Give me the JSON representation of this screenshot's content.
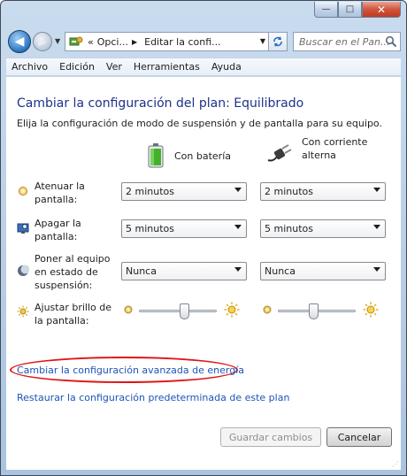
{
  "window": {
    "minimize_glyph": "—",
    "maximize_glyph": "□",
    "close_glyph": "✕"
  },
  "nav": {
    "back_glyph": "◀",
    "forward_glyph": "▶",
    "breadcrumb_prefix": "«",
    "crumb1": "Opci...",
    "crumb2": "Editar la confi...",
    "search_placeholder": "Buscar en el Pan..."
  },
  "menu": {
    "items": [
      "Archivo",
      "Edición",
      "Ver",
      "Herramientas",
      "Ayuda"
    ]
  },
  "page": {
    "title": "Cambiar la configuración del plan: Equilibrado",
    "subtitle": "Elija la configuración de modo de suspensión y de pantalla para su equipo.",
    "col_battery": "Con batería",
    "col_ac_line1": "Con corriente",
    "col_ac_line2": "alterna"
  },
  "settings": {
    "dim": {
      "label_line1": "Atenuar la",
      "label_line2": "pantalla:",
      "battery": "2 minutos",
      "ac": "2 minutos"
    },
    "off": {
      "label_line1": "Apagar la",
      "label_line2": "pantalla:",
      "battery": "5 minutos",
      "ac": "5 minutos"
    },
    "sleep": {
      "label_line1": "Poner al equipo",
      "label_line2": "en estado de",
      "label_line3": "suspensión:",
      "battery": "Nunca",
      "ac": "Nunca"
    },
    "brightness": {
      "label_line1": "Ajustar brillo de",
      "label_line2": "la pantalla:",
      "battery_level": 0.6,
      "ac_level": 0.45
    }
  },
  "links": {
    "advanced": "Cambiar la configuración avanzada de energía",
    "restore": "Restaurar la configuración predeterminada de este plan"
  },
  "buttons": {
    "save": "Guardar cambios",
    "cancel": "Cancelar"
  },
  "colors": {
    "title": "#1e3287",
    "link": "#1c54b7",
    "highlight": "#e01515"
  }
}
